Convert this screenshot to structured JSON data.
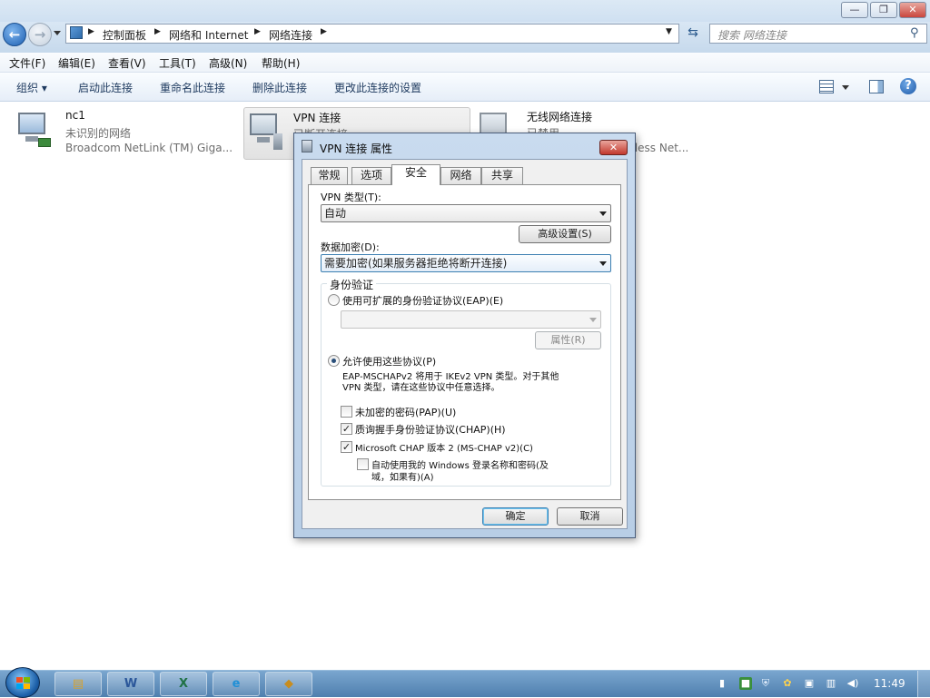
{
  "explorer": {
    "breadcrumb": [
      "控制面板",
      "网络和 Internet",
      "网络连接"
    ],
    "search_placeholder": "搜索 网络连接",
    "menu": [
      "文件(F)",
      "编辑(E)",
      "查看(V)",
      "工具(T)",
      "高级(N)",
      "帮助(H)"
    ],
    "commands": [
      "组织 ▾",
      "启动此连接",
      "重命名此连接",
      "删除此连接",
      "更改此连接的设置"
    ],
    "connections": [
      {
        "name": "nc1",
        "status": "未识别的网络",
        "device": "Broadcom NetLink (TM) Giga..."
      },
      {
        "name": "VPN 连接",
        "status": "已断开连接",
        "device": ""
      },
      {
        "name": "无线网络连接",
        "status": "已禁用",
        "device": "...eless Net..."
      }
    ]
  },
  "dialog": {
    "title": "VPN 连接 属性",
    "tabs": [
      "常规",
      "选项",
      "安全",
      "网络",
      "共享"
    ],
    "active_tab": "安全",
    "vpn_type_label": "VPN 类型(T):",
    "vpn_type_value": "自动",
    "advanced_button": "高级设置(S)",
    "encryption_label": "数据加密(D):",
    "encryption_value": "需要加密(如果服务器拒绝将断开连接)",
    "auth_group": "身份验证",
    "eap_radio": "使用可扩展的身份验证协议(EAP)(E)",
    "eap_properties_button": "属性(R)",
    "allow_radio": "允许使用这些协议(P)",
    "allow_note_1": "EAP-MSCHAPv2 将用于 IKEv2 VPN 类型。对于其他",
    "allow_note_2": "VPN 类型，请在这些协议中任意选择。",
    "pap_label": "未加密的密码(PAP)(U)",
    "pap_checked": false,
    "chap_label": "质询握手身份验证协议(CHAP)(H)",
    "chap_checked": true,
    "mschap_label": "Microsoft CHAP 版本 2 (MS-CHAP v2)(C)",
    "mschap_checked": true,
    "autologon_label_1": "自动使用我的 Windows 登录名称和密码(及",
    "autologon_label_2": "域，如果有)(A)",
    "autologon_checked": false,
    "ok_button": "确定",
    "cancel_button": "取消",
    "close_glyph": "✕"
  },
  "taskbar": {
    "apps": [
      "explorer",
      "word",
      "excel",
      "ie",
      "folder-tool",
      "network"
    ],
    "clock": "11:49"
  },
  "colors": {
    "accent": "#1e3a5f",
    "titlebar": "#cfe0f1",
    "taskbar": "#5b8bba",
    "close_red": "#c9463d"
  }
}
